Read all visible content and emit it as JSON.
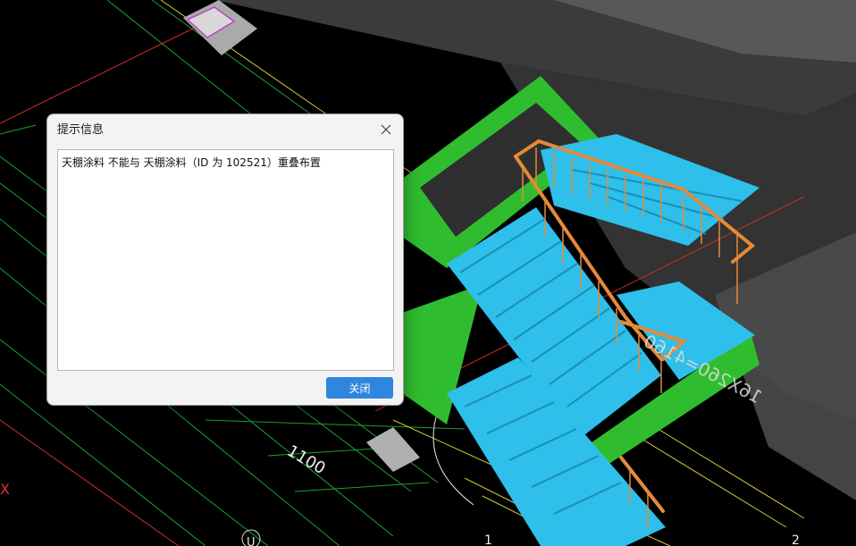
{
  "dialog": {
    "title": "提示信息",
    "message": "天棚涂料 不能与 天棚涂料（ID 为 102521）重叠布置",
    "close_button_label": "关闭",
    "close_icon": "close-icon"
  },
  "drawing": {
    "dimension_label_1": "1100",
    "dimension_label_2": "16X260=4160",
    "axis_label_1": "1",
    "axis_label_2": "2",
    "axis_label_u": "U",
    "edge_label_x": "X"
  },
  "colors": {
    "stair_blue": "#2ebfea",
    "railing_orange": "#e58a3a",
    "slab_green": "#2fbd2f",
    "button_blue": "#2f86de"
  }
}
